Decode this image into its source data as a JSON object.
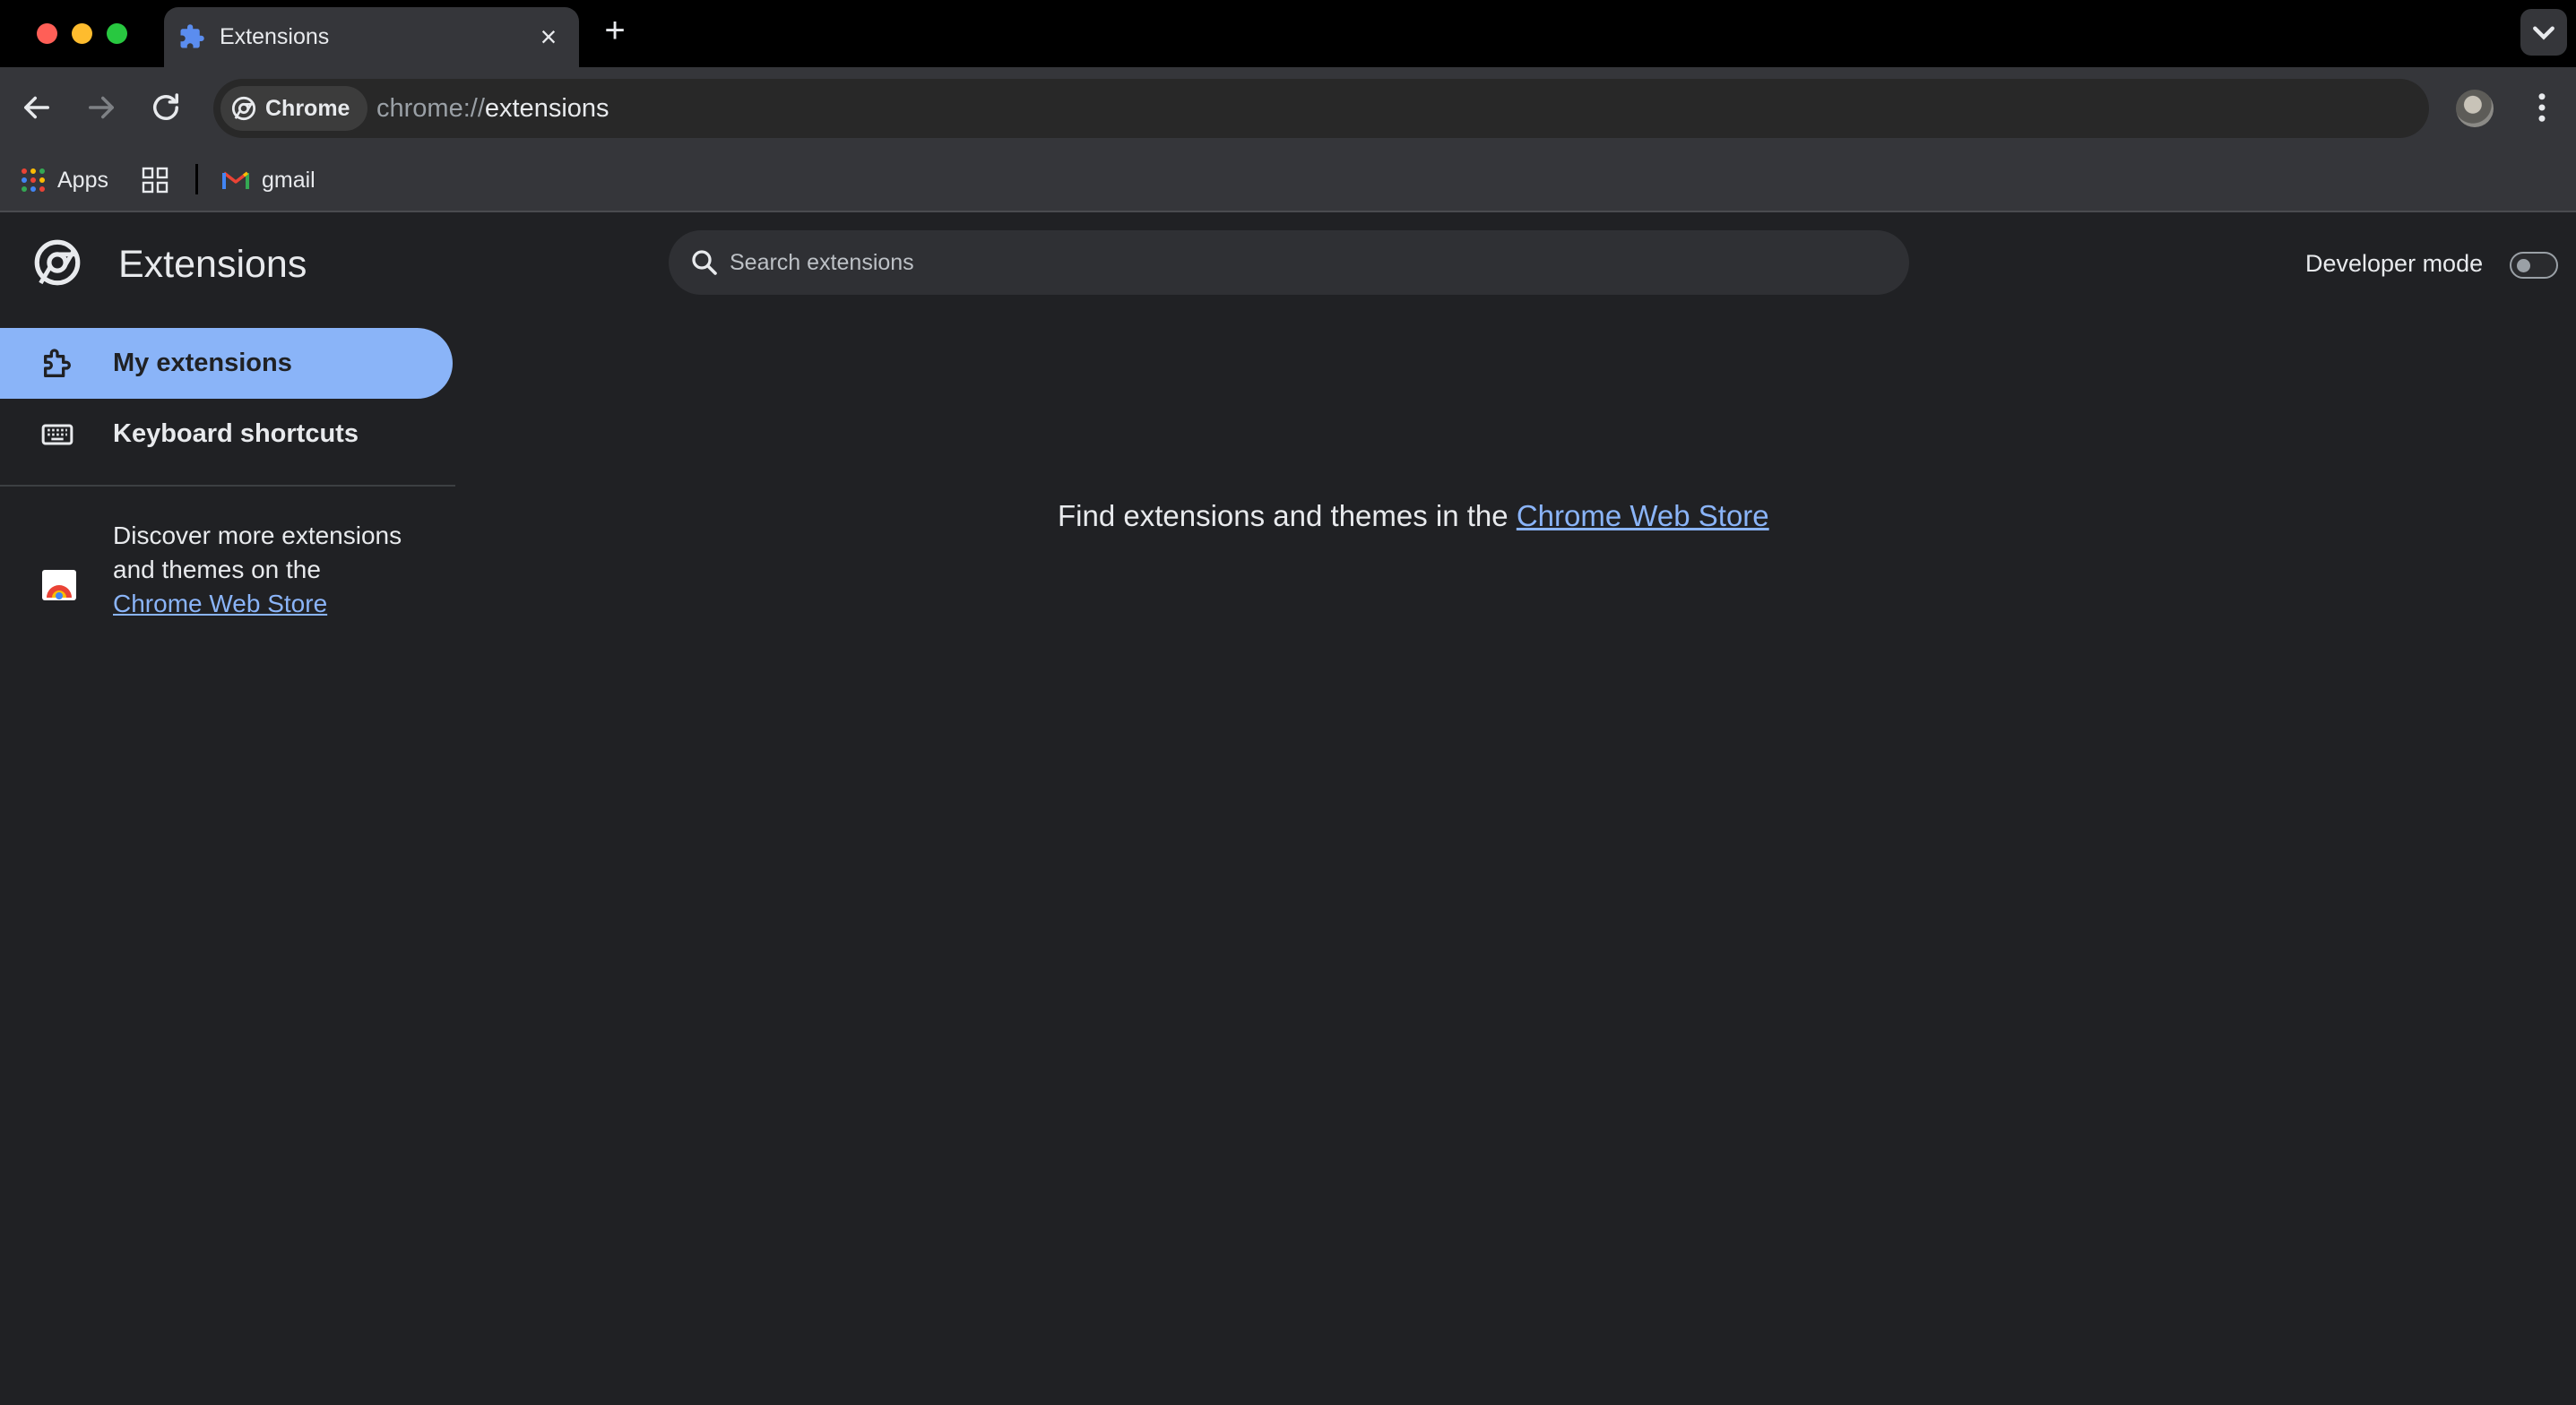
{
  "tab": {
    "title": "Extensions",
    "close": "×"
  },
  "new_tab": "+",
  "omnibox": {
    "chip_label": "Chrome",
    "url_scheme": "chrome://",
    "url_host": "extensions"
  },
  "bookmarks": [
    {
      "label": "Apps",
      "icon": "apps-grid-icon"
    },
    {
      "label": "",
      "icon": "tab-groups-icon"
    },
    {
      "label": "gmail",
      "icon": "gmail-icon"
    }
  ],
  "page": {
    "title": "Extensions",
    "search_placeholder": "Search extensions",
    "developer_mode_label": "Developer mode",
    "developer_mode_on": false
  },
  "sidebar": {
    "items": [
      {
        "label": "My extensions",
        "icon": "extension-puzzle-icon",
        "active": true
      },
      {
        "label": "Keyboard shortcuts",
        "icon": "keyboard-icon",
        "active": false
      }
    ],
    "promo_prefix": "Discover more extensions and themes on the ",
    "promo_link": "Chrome Web Store"
  },
  "main": {
    "empty_prefix": "Find extensions and themes in the ",
    "empty_link": "Chrome Web Store"
  },
  "colors": {
    "accent": "#8ab4f8",
    "background": "#202124",
    "toolbar": "#35363a"
  }
}
